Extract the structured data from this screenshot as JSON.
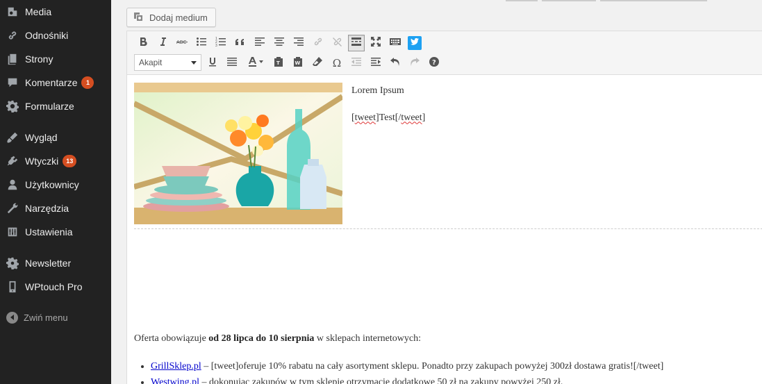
{
  "sidebar": {
    "items": [
      {
        "label": "Media",
        "icon": "media-icon",
        "badge": ""
      },
      {
        "label": "Odnośniki",
        "icon": "link-icon",
        "badge": ""
      },
      {
        "label": "Strony",
        "icon": "pages-icon",
        "badge": ""
      },
      {
        "label": "Komentarze",
        "icon": "comments-icon",
        "badge": "1"
      },
      {
        "label": "Formularze",
        "icon": "gear-icon",
        "badge": ""
      },
      {
        "label": "Wygląd",
        "icon": "appearance-icon",
        "badge": ""
      },
      {
        "label": "Wtyczki",
        "icon": "plugins-icon",
        "badge": "13"
      },
      {
        "label": "Użytkownicy",
        "icon": "users-icon",
        "badge": ""
      },
      {
        "label": "Narzędzia",
        "icon": "tools-icon",
        "badge": ""
      },
      {
        "label": "Ustawienia",
        "icon": "settings-icon",
        "badge": ""
      },
      {
        "label": "Newsletter",
        "icon": "gear-icon",
        "badge": ""
      },
      {
        "label": "WPtouch Pro",
        "icon": "mobile-icon",
        "badge": ""
      }
    ],
    "collapse_label": "Zwiń menu"
  },
  "editor": {
    "add_media_label": "Dodaj medium",
    "format_select_value": "Akapit",
    "toolbar_row1": [
      "bold-icon",
      "italic-icon",
      "strikethrough-icon",
      "bullet-list-icon",
      "numbered-list-icon",
      "blockquote-icon",
      "align-left-icon",
      "align-center-icon",
      "align-right-icon",
      "insert-link-icon",
      "unlink-icon",
      "read-more-icon",
      "fullscreen-icon",
      "toolbar-toggle-icon",
      "twitter-icon"
    ],
    "toolbar_row2": [
      "underline-icon",
      "justify-icon",
      "text-color-icon",
      "paste-text-icon",
      "paste-word-icon",
      "clear-formatting-icon",
      "special-character-icon",
      "outdent-icon",
      "indent-icon",
      "undo-icon",
      "redo-icon",
      "help-icon"
    ]
  },
  "content": {
    "side_line1": "Lorem Ipsum",
    "side_line2_a": "[",
    "side_line2_b": "tweet",
    "side_line2_c": "]Test[/",
    "side_line2_d": "tweet",
    "side_line2_e": "]",
    "offer_prefix": "Oferta obowiązuje ",
    "offer_bold": "od 28 lipca do 10 sierpnia",
    "offer_suffix": " w sklepach internetowych:",
    "list": [
      {
        "link": "GrillSklep.pl",
        "text": " – [tweet]oferuje  10% rabatu na cały asortyment sklepu. Ponadto przy zakupach powyżej 300zł dostawa gratis![/tweet]"
      },
      {
        "link": "Westwing.pl",
        "text": " – dokonując zakupów w tym sklepie otrzymacie dodatkowe 50 zł na zakupy powyżej 250 zł."
      }
    ]
  }
}
